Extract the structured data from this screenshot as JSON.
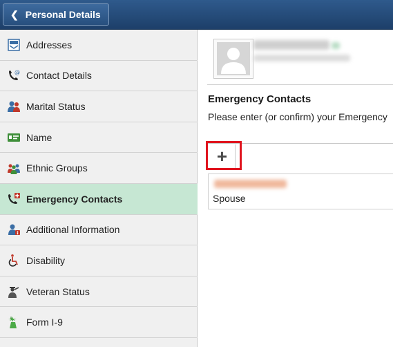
{
  "header": {
    "back_label": "Personal Details"
  },
  "sidebar": {
    "items": [
      {
        "label": "Addresses",
        "icon": "address-card-icon",
        "active": false
      },
      {
        "label": "Contact Details",
        "icon": "phone-at-icon",
        "active": false
      },
      {
        "label": "Marital Status",
        "icon": "two-people-icon",
        "active": false
      },
      {
        "label": "Name",
        "icon": "id-badge-icon",
        "active": false
      },
      {
        "label": "Ethnic Groups",
        "icon": "group-people-icon",
        "active": false
      },
      {
        "label": "Emergency Contacts",
        "icon": "phone-medical-icon",
        "active": true
      },
      {
        "label": "Additional Information",
        "icon": "person-info-icon",
        "active": false
      },
      {
        "label": "Disability",
        "icon": "wheelchair-icon",
        "active": false
      },
      {
        "label": "Veteran Status",
        "icon": "saluting-person-icon",
        "active": false
      },
      {
        "label": "Form I-9",
        "icon": "statue-of-liberty-icon",
        "active": false
      }
    ]
  },
  "main": {
    "section_title": "Emergency Contacts",
    "instructions": "Please enter (or confirm) your Emergency",
    "add_label": "+",
    "contacts": [
      {
        "relationship": "Spouse"
      }
    ]
  },
  "colors": {
    "header_bg": "#274f7e",
    "active_item_bg": "#c6e7d3",
    "highlight_border": "#e0141e"
  }
}
